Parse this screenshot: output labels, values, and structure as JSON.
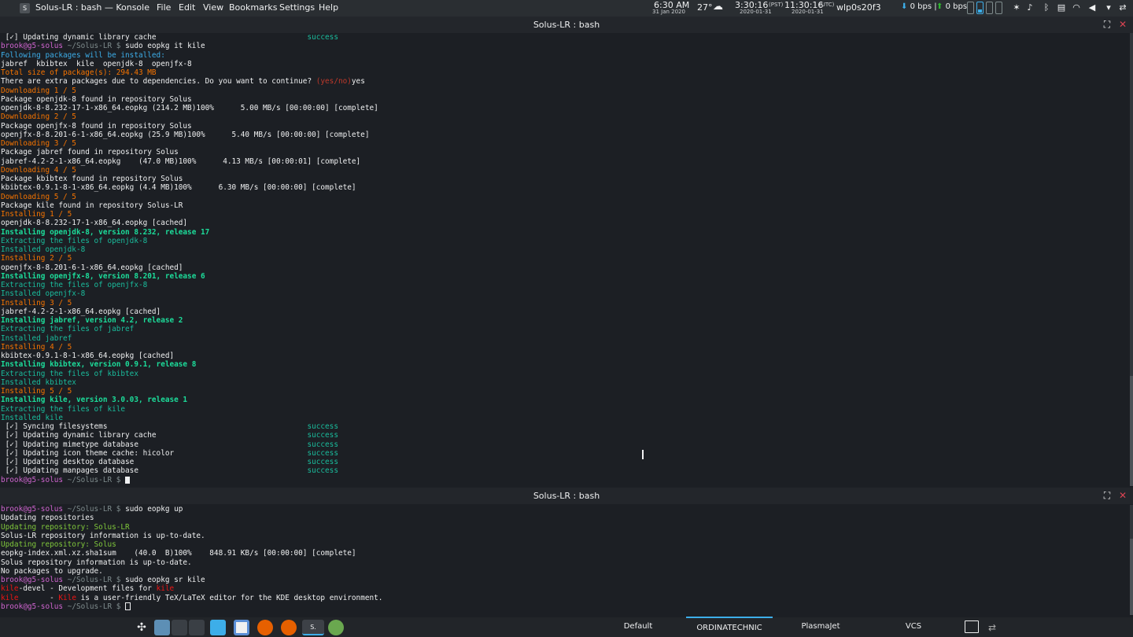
{
  "topbar": {
    "app_title": "Solus-LR : bash — Konsole",
    "app_icon": "S",
    "menu": [
      "File",
      "Edit",
      "View",
      "Bookmarks",
      "Settings",
      "Help"
    ],
    "clock_time": "6:30 AM",
    "clock_date": "31 Jan 2020",
    "temperature": "27°",
    "weather_icon": "cloud-icon",
    "local_time": "3:30:16",
    "local_tz": "(PST)",
    "local_date": "2020-01-31",
    "utc_time": "11:30:16",
    "utc_tz": "(UTC)",
    "utc_date": "2020-01-31",
    "network_iface": "wlp0s20f3",
    "net_down": "0 bps",
    "net_up": "0 bps",
    "tray_icons": [
      "pin-icon",
      "bell-icon",
      "microphone-icon",
      "bluetooth-icon",
      "clipboard-icon",
      "wifi-icon",
      "volume-icon",
      "chevron-down-icon",
      "switch-icon"
    ]
  },
  "pane_top": {
    "title": "Solus-LR : bash",
    "lines": [
      [
        {
          "t": " [✓] Updating dynamic library cache                                  ",
          "c": "c-white"
        },
        {
          "t": "success",
          "c": "c-teal"
        }
      ],
      [
        {
          "t": "brook@g5-solus",
          "c": "c-pink"
        },
        {
          "t": " ~/Solus-LR $ ",
          "c": "c-dim"
        },
        {
          "t": "sudo eopkg it kile",
          "c": "c-white"
        }
      ],
      [
        {
          "t": "Following packages will be installed:",
          "c": "c-blue"
        }
      ],
      [
        {
          "t": "jabref  kbibtex  kile  openjdk-8  openjfx-8",
          "c": "c-white"
        }
      ],
      [
        {
          "t": "Total size of package(s): 294.43 MB",
          "c": "c-orange"
        }
      ],
      [
        {
          "t": "There are extra packages due to dependencies. Do you want to continue? ",
          "c": "c-white"
        },
        {
          "t": "(yes/no)",
          "c": "c-redtxt"
        },
        {
          "t": "yes",
          "c": "c-white"
        }
      ],
      [
        {
          "t": "Downloading 1 / 5",
          "c": "c-orange"
        }
      ],
      [
        {
          "t": "Package openjdk-8 found in repository Solus",
          "c": "c-white"
        }
      ],
      [
        {
          "t": "openjdk-8-8.232-17-1-x86_64.eopkg (214.2 MB)100%      5.00 MB/s [00:00:00] [complete]",
          "c": "c-white"
        }
      ],
      [
        {
          "t": "Downloading 2 / 5",
          "c": "c-orange"
        }
      ],
      [
        {
          "t": "Package openjfx-8 found in repository Solus",
          "c": "c-white"
        }
      ],
      [
        {
          "t": "openjfx-8-8.201-6-1-x86_64.eopkg (25.9 MB)100%      5.40 MB/s [00:00:00] [complete]",
          "c": "c-white"
        }
      ],
      [
        {
          "t": "Downloading 3 / 5",
          "c": "c-orange"
        }
      ],
      [
        {
          "t": "Package jabref found in repository Solus",
          "c": "c-white"
        }
      ],
      [
        {
          "t": "jabref-4.2-2-1-x86_64.eopkg    (47.0 MB)100%      4.13 MB/s [00:00:01] [complete]",
          "c": "c-white"
        }
      ],
      [
        {
          "t": "Downloading 4 / 5",
          "c": "c-orange"
        }
      ],
      [
        {
          "t": "Package kbibtex found in repository Solus",
          "c": "c-white"
        }
      ],
      [
        {
          "t": "kbibtex-0.9.1-8-1-x86_64.eopkg (4.4 MB)100%      6.30 MB/s [00:00:00] [complete]",
          "c": "c-white"
        }
      ],
      [
        {
          "t": "Downloading 5 / 5",
          "c": "c-orange"
        }
      ],
      [
        {
          "t": "Package kile found in repository Solus-LR",
          "c": "c-white"
        }
      ],
      [
        {
          "t": "Installing 1 / 5",
          "c": "c-orange"
        }
      ],
      [
        {
          "t": "openjdk-8-8.232-17-1-x86_64.eopkg [cached]",
          "c": "c-white"
        }
      ],
      [
        {
          "t": "Installing openjdk-8, version 8.232, release 17",
          "c": "c-green-bold"
        }
      ],
      [
        {
          "t": "Extracting the files of openjdk-8",
          "c": "c-teal"
        }
      ],
      [
        {
          "t": "Installed openjdk-8",
          "c": "c-teal"
        }
      ],
      [
        {
          "t": "Installing 2 / 5",
          "c": "c-orange"
        }
      ],
      [
        {
          "t": "openjfx-8-8.201-6-1-x86_64.eopkg [cached]",
          "c": "c-white"
        }
      ],
      [
        {
          "t": "Installing openjfx-8, version 8.201, release 6",
          "c": "c-green-bold"
        }
      ],
      [
        {
          "t": "Extracting the files of openjfx-8",
          "c": "c-teal"
        }
      ],
      [
        {
          "t": "Installed openjfx-8",
          "c": "c-teal"
        }
      ],
      [
        {
          "t": "Installing 3 / 5",
          "c": "c-orange"
        }
      ],
      [
        {
          "t": "jabref-4.2-2-1-x86_64.eopkg [cached]",
          "c": "c-white"
        }
      ],
      [
        {
          "t": "Installing jabref, version 4.2, release 2",
          "c": "c-green-bold"
        }
      ],
      [
        {
          "t": "Extracting the files of jabref",
          "c": "c-teal"
        }
      ],
      [
        {
          "t": "Installed jabref",
          "c": "c-teal"
        }
      ],
      [
        {
          "t": "Installing 4 / 5",
          "c": "c-orange"
        }
      ],
      [
        {
          "t": "kbibtex-0.9.1-8-1-x86_64.eopkg [cached]",
          "c": "c-white"
        }
      ],
      [
        {
          "t": "Installing kbibtex, version 0.9.1, release 8",
          "c": "c-green-bold"
        }
      ],
      [
        {
          "t": "Extracting the files of kbibtex",
          "c": "c-teal"
        }
      ],
      [
        {
          "t": "Installed kbibtex",
          "c": "c-teal"
        }
      ],
      [
        {
          "t": "Installing 5 / 5",
          "c": "c-orange"
        }
      ],
      [
        {
          "t": "Installing kile, version 3.0.03, release 1",
          "c": "c-green-bold"
        }
      ],
      [
        {
          "t": "Extracting the files of kile",
          "c": "c-teal"
        }
      ],
      [
        {
          "t": "Installed kile",
          "c": "c-teal"
        }
      ],
      [
        {
          "t": " [✓] Syncing filesystems                                             ",
          "c": "c-white"
        },
        {
          "t": "success",
          "c": "c-teal"
        }
      ],
      [
        {
          "t": " [✓] Updating dynamic library cache                                  ",
          "c": "c-white"
        },
        {
          "t": "success",
          "c": "c-teal"
        }
      ],
      [
        {
          "t": " [✓] Updating mimetype database                                      ",
          "c": "c-white"
        },
        {
          "t": "success",
          "c": "c-teal"
        }
      ],
      [
        {
          "t": " [✓] Updating icon theme cache: hicolor                              ",
          "c": "c-white"
        },
        {
          "t": "success",
          "c": "c-teal"
        }
      ],
      [
        {
          "t": " [✓] Updating desktop database                                       ",
          "c": "c-white"
        },
        {
          "t": "success",
          "c": "c-teal"
        }
      ],
      [
        {
          "t": " [✓] Updating manpages database                                      ",
          "c": "c-white"
        },
        {
          "t": "success",
          "c": "c-teal"
        }
      ],
      [
        {
          "t": "brook@g5-solus",
          "c": "c-pink"
        },
        {
          "t": " ~/Solus-LR $ ",
          "c": "c-dim"
        },
        {
          "t": "",
          "c": "cursor"
        }
      ]
    ]
  },
  "pane_bottom": {
    "title": "Solus-LR : bash",
    "lines": [
      [
        {
          "t": "brook@g5-solus",
          "c": "c-pink"
        },
        {
          "t": " ~/Solus-LR $ ",
          "c": "c-dim"
        },
        {
          "t": "sudo eopkg up",
          "c": "c-white"
        }
      ],
      [
        {
          "t": "Updating repositories",
          "c": "c-white"
        }
      ],
      [
        {
          "t": "Updating repository: Solus-LR",
          "c": "c-yellowgreen"
        }
      ],
      [
        {
          "t": "Solus-LR repository information is up-to-date.",
          "c": "c-white"
        }
      ],
      [
        {
          "t": "Updating repository: Solus",
          "c": "c-yellowgreen"
        }
      ],
      [
        {
          "t": "eopkg-index.xml.xz.sha1sum    (40.0  B)100%    848.91 KB/s [00:00:00] [complete]",
          "c": "c-white"
        }
      ],
      [
        {
          "t": "Solus repository information is up-to-date.",
          "c": "c-white"
        }
      ],
      [
        {
          "t": "No packages to upgrade.",
          "c": "c-white"
        }
      ],
      [
        {
          "t": "brook@g5-solus",
          "c": "c-pink"
        },
        {
          "t": " ~/Solus-LR $ ",
          "c": "c-dim"
        },
        {
          "t": "sudo eopkg sr kile",
          "c": "c-white"
        }
      ],
      [
        {
          "t": "kile",
          "c": "c-red"
        },
        {
          "t": "-devel - Development files for ",
          "c": "c-white"
        },
        {
          "t": "kile",
          "c": "c-red"
        }
      ],
      [
        {
          "t": "kile",
          "c": "c-red"
        },
        {
          "t": "       - ",
          "c": "c-white"
        },
        {
          "t": "Kile",
          "c": "c-red"
        },
        {
          "t": " is a user-friendly TeX/LaTeX editor for the KDE desktop environment.",
          "c": "c-white"
        }
      ],
      [
        {
          "t": "brook@g5-solus",
          "c": "c-pink"
        },
        {
          "t": " ~/Solus-LR $ ",
          "c": "c-dim"
        },
        {
          "t": "",
          "c": "cursor-hollow"
        }
      ]
    ]
  },
  "taskbar": {
    "launcher_icon": "app-launcher-icon",
    "tasks": [
      {
        "name": "desktop-pager-icon",
        "color": "#5d8fb5"
      },
      {
        "name": "pager-window-icon",
        "color": "#3a3f45"
      },
      {
        "name": "file-manager-icon",
        "color": "#3daee9"
      },
      {
        "name": "text-editor-icon",
        "color": "#5b8fd6"
      },
      {
        "name": "firefox-icon",
        "color": "#e66000"
      },
      {
        "name": "firefox-icon-2",
        "color": "#e66000"
      },
      {
        "name": "konsole-icon",
        "color": "#31363b"
      },
      {
        "name": "settings-icon",
        "color": "#6aa84f"
      }
    ],
    "activities": [
      "Default",
      "ORDINATECHNIC",
      "PlasmaJet",
      "VCS"
    ],
    "active_activity": "ORDINATECHNIC",
    "show_desktop_icon": "show-desktop-icon",
    "panel_config_icon": "panel-config-icon"
  }
}
